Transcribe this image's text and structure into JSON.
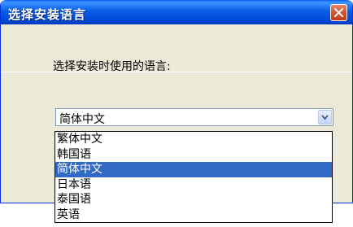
{
  "window": {
    "title": "选择安装语言"
  },
  "dialog": {
    "prompt": "选择安装时使用的语言:",
    "combo": {
      "selected": "简体中文"
    },
    "options": [
      {
        "label": "繁体中文",
        "selected": false
      },
      {
        "label": "韩国语",
        "selected": false
      },
      {
        "label": "简体中文",
        "selected": true
      },
      {
        "label": "日本语",
        "selected": false
      },
      {
        "label": "泰国语",
        "selected": false
      },
      {
        "label": "英语",
        "selected": false
      }
    ]
  },
  "icons": {
    "close": "close-icon",
    "dropdown": "chevron-down-icon"
  },
  "colors": {
    "titlebar": "#0a5de8",
    "selection": "#316ac5",
    "dialog_bg": "#ece9d8"
  }
}
